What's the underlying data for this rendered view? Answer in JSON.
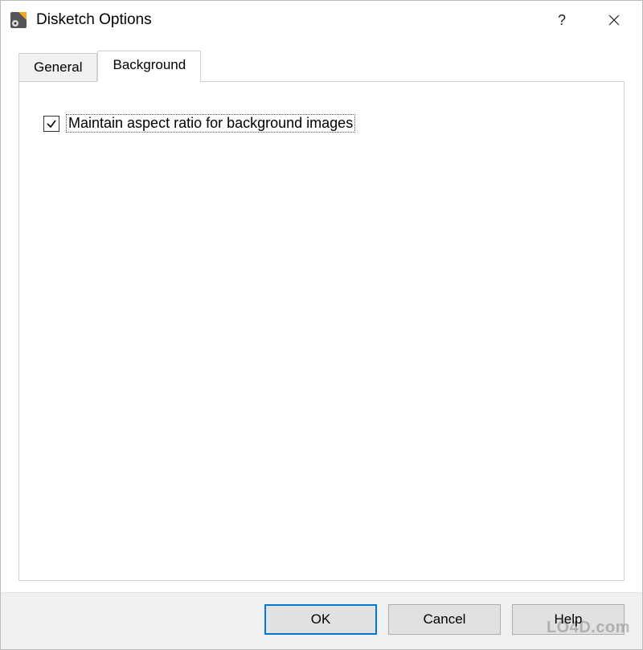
{
  "window": {
    "title": "Disketch Options"
  },
  "titlebar": {
    "help": "?",
    "close": "✕"
  },
  "tabs": {
    "general": "General",
    "background": "Background"
  },
  "options": {
    "maintain_aspect_label": "Maintain aspect ratio for background images",
    "maintain_aspect_checked": true
  },
  "buttons": {
    "ok": "OK",
    "cancel": "Cancel",
    "help": "Help"
  },
  "watermark": "LO4D.com"
}
